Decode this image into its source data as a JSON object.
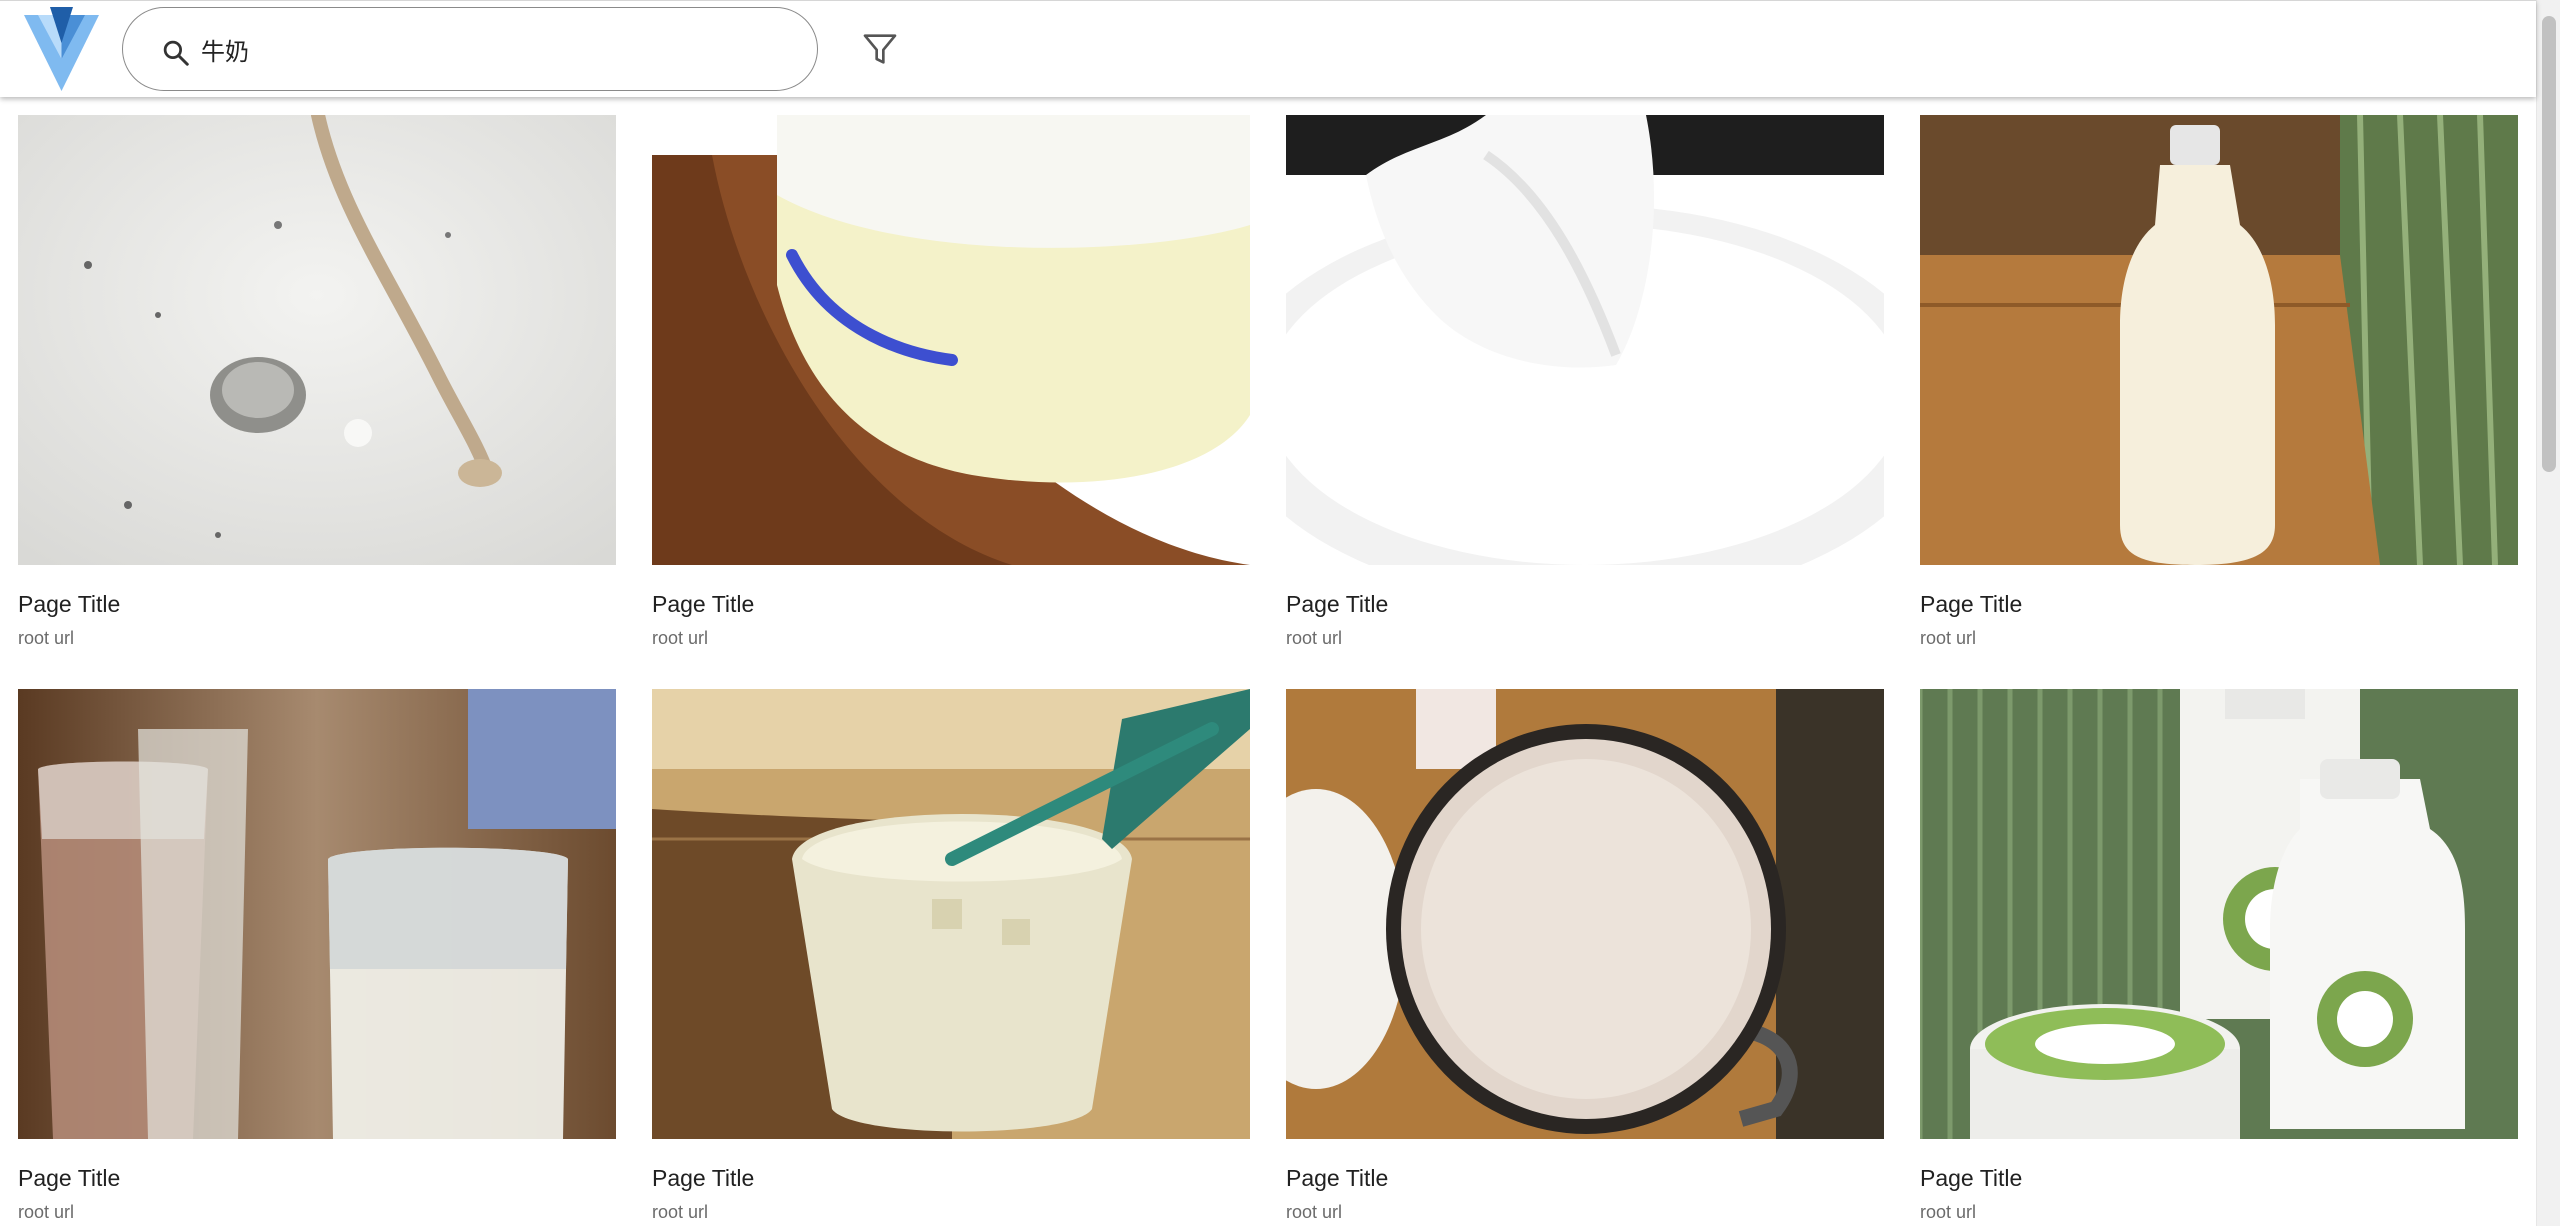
{
  "search": {
    "query": "牛奶"
  },
  "results": [
    {
      "title": "Page Title",
      "url": "root url",
      "image": "milk-splash-drop"
    },
    {
      "title": "Page Title",
      "url": "root url",
      "image": "milk-bucket-on-table"
    },
    {
      "title": "Page Title",
      "url": "root url",
      "image": "milk-splash-bowl"
    },
    {
      "title": "Page Title",
      "url": "root url",
      "image": "milk-bottle-on-table"
    },
    {
      "title": "Page Title",
      "url": "root url",
      "image": "champagne-and-milk-glasses"
    },
    {
      "title": "Page Title",
      "url": "root url",
      "image": "milkshake-glass-with-straw"
    },
    {
      "title": "Page Title",
      "url": "root url",
      "image": "milk-mug-top-view"
    },
    {
      "title": "Page Title",
      "url": "root url",
      "image": "goat-milk-bottles"
    }
  ],
  "colors": {
    "accent": "#2b78c2",
    "accent_light": "#9ecbf2"
  }
}
